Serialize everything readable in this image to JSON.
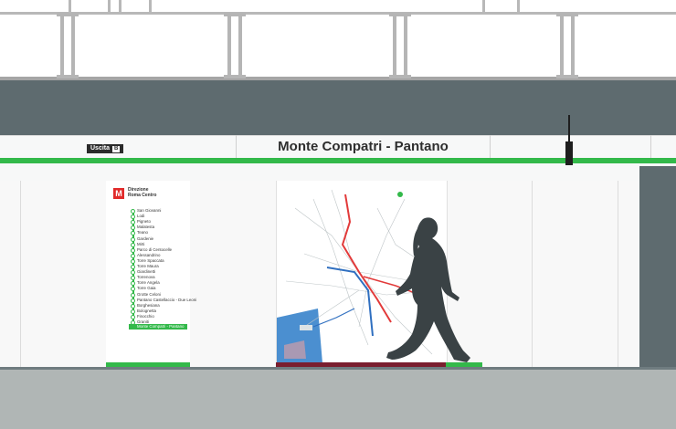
{
  "station": {
    "name": "Monte Compatri - Pantano"
  },
  "exit_sign": {
    "label": "Uscita",
    "number": "B"
  },
  "line_diagram": {
    "logo": "M",
    "direction": [
      "Direzione",
      "Roma Centro"
    ],
    "stops": [
      "San Giovanni",
      "Lodi",
      "Pigneto",
      "Malatesta",
      "Teano",
      "Gardenie",
      "Mirti",
      "Parco di Centocelle",
      "Alessandrino",
      "Torre Spaccata",
      "Torre Maura",
      "Giardinetti",
      "Torrenova",
      "Torre Angela",
      "Torre Gaia",
      "Grotte Celoni",
      "Pantano Castellaccio - Due Leoni",
      "Borghesiana",
      "Bolognetta",
      "Finocchio",
      "Graniti"
    ],
    "final_stop": "Monte Compatri - Pantano",
    "line_color": "#33b94a"
  },
  "colors": {
    "line_green": "#33b94a",
    "beam": "#5e6b6f",
    "map_bar": "#7a1e2e",
    "logo_red": "#e12a2a"
  }
}
